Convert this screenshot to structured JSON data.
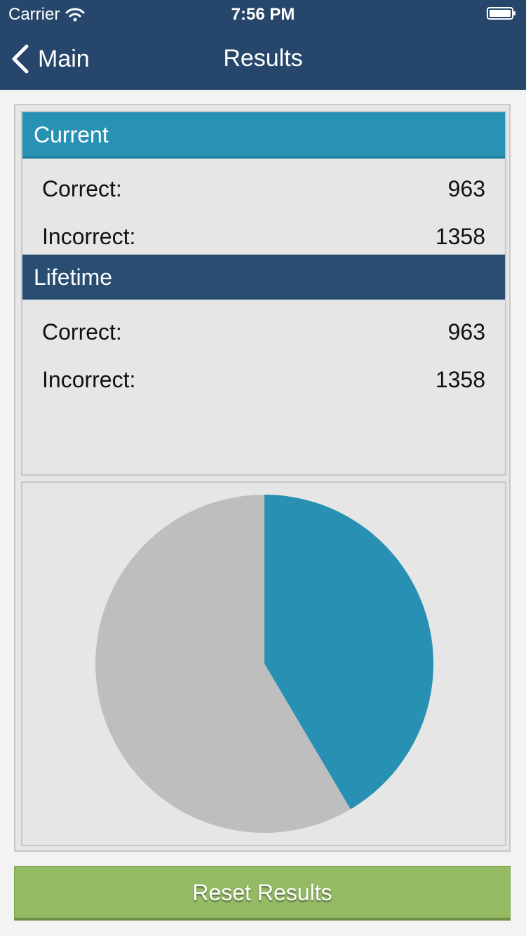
{
  "status_bar": {
    "carrier": "Carrier",
    "time": "7:56 PM",
    "icons": [
      "wifi-icon",
      "battery-icon"
    ]
  },
  "nav": {
    "back_label": "Main",
    "back_icon": "chevron-left-icon",
    "title": "Results"
  },
  "current": {
    "header": "Current",
    "correct_label": "Correct:",
    "correct_value": "963",
    "incorrect_label": "Incorrect:",
    "incorrect_value": "1358"
  },
  "lifetime": {
    "header": "Lifetime",
    "correct_label": "Correct:",
    "correct_value": "963",
    "incorrect_label": "Incorrect:",
    "incorrect_value": "1358"
  },
  "reset_button": "Reset Results",
  "colors": {
    "nav_bg": "#26476b",
    "current_header": "#2792b3",
    "lifetime_header": "#2a4d72",
    "correct_slice": "#2891b3",
    "incorrect_slice": "#bebebe",
    "reset_button": "#94ba64"
  },
  "chart_data": {
    "type": "pie",
    "categories": [
      "Correct",
      "Incorrect"
    ],
    "values": [
      963,
      1358
    ],
    "colors": [
      "#2891b3",
      "#bebebe"
    ]
  }
}
